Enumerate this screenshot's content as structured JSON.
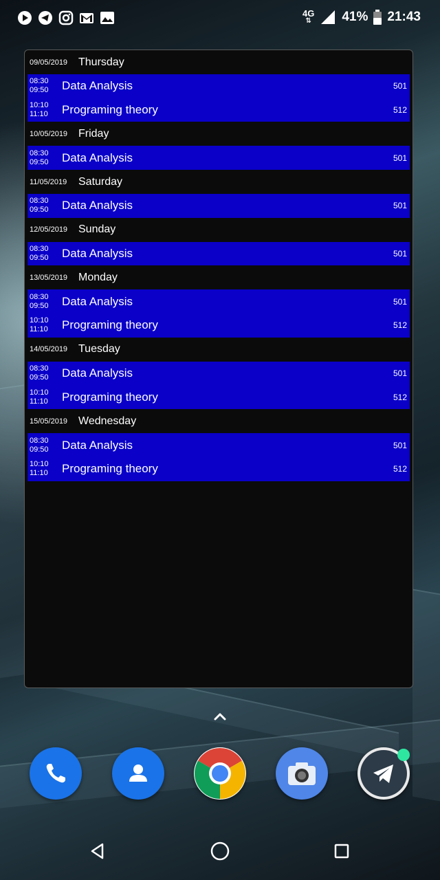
{
  "status_bar": {
    "left_icons": [
      "play-icon",
      "telegram-icon",
      "instagram-icon",
      "gmail-icon",
      "gallery-icon"
    ],
    "network": "4G",
    "battery": "41%",
    "time": "21:43"
  },
  "schedule": [
    {
      "date": "09/05/2019",
      "day": "Thursday",
      "lessons": [
        {
          "start": "08:30",
          "end": "09:50",
          "subject": "Data Analysis",
          "room": "501"
        },
        {
          "start": "10:10",
          "end": "11:10",
          "subject": "Programing theory",
          "room": "512"
        }
      ]
    },
    {
      "date": "10/05/2019",
      "day": "Friday",
      "lessons": [
        {
          "start": "08:30",
          "end": "09:50",
          "subject": "Data Analysis",
          "room": "501"
        }
      ]
    },
    {
      "date": "11/05/2019",
      "day": "Saturday",
      "lessons": [
        {
          "start": "08:30",
          "end": "09:50",
          "subject": "Data Analysis",
          "room": "501"
        }
      ]
    },
    {
      "date": "12/05/2019",
      "day": "Sunday",
      "lessons": [
        {
          "start": "08:30",
          "end": "09:50",
          "subject": "Data Analysis",
          "room": "501"
        }
      ]
    },
    {
      "date": "13/05/2019",
      "day": "Monday",
      "lessons": [
        {
          "start": "08:30",
          "end": "09:50",
          "subject": "Data Analysis",
          "room": "501"
        },
        {
          "start": "10:10",
          "end": "11:10",
          "subject": "Programing theory",
          "room": "512"
        }
      ]
    },
    {
      "date": "14/05/2019",
      "day": "Tuesday",
      "lessons": [
        {
          "start": "08:30",
          "end": "09:50",
          "subject": "Data Analysis",
          "room": "501"
        },
        {
          "start": "10:10",
          "end": "11:10",
          "subject": "Programing theory",
          "room": "512"
        }
      ]
    },
    {
      "date": "15/05/2019",
      "day": "Wednesday",
      "lessons": [
        {
          "start": "08:30",
          "end": "09:50",
          "subject": "Data Analysis",
          "room": "501"
        },
        {
          "start": "10:10",
          "end": "11:10",
          "subject": "Programing theory",
          "room": "512"
        }
      ]
    }
  ],
  "dock": {
    "apps": [
      "phone-icon",
      "contacts-icon",
      "chrome-icon",
      "camera-icon",
      "telegram-icon"
    ]
  },
  "colors": {
    "lesson_background": "#0a00c8",
    "widget_background": "#0b0b0c",
    "telegram_badge": "#2ee6a0"
  }
}
